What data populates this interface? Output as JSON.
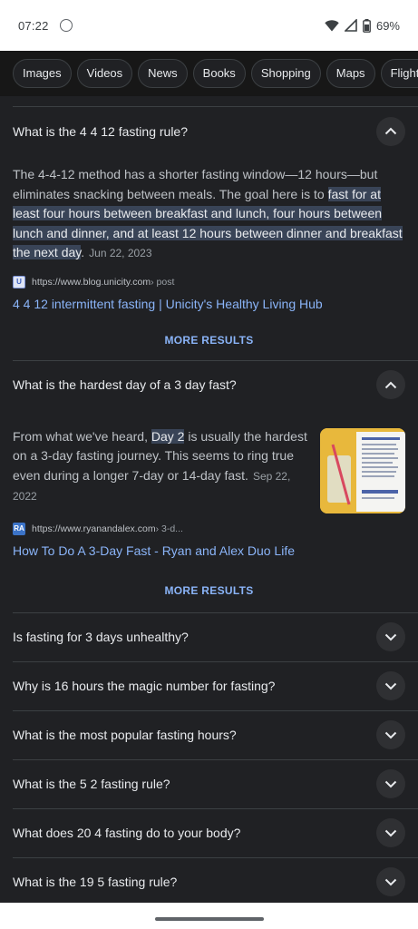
{
  "status": {
    "time": "07:22",
    "battery": "69%"
  },
  "chips": [
    "Images",
    "Videos",
    "News",
    "Books",
    "Shopping",
    "Maps",
    "Flights"
  ],
  "faq1": {
    "question": "What is the 4 4 12 fasting rule?",
    "text_before": "The 4-4-12 method has a shorter fasting window—12 hours—but eliminates snacking between meals. The goal here is to ",
    "highlight": "fast for at least four hours between breakfast and lunch, four hours between lunch and dinner, and at least 12 hours between dinner and breakfast the next day",
    "text_after": ".",
    "date": "Jun 22, 2023",
    "source_url": "https://www.blog.unicity.com",
    "source_path": " › post",
    "favicon": "U",
    "link": "4 4 12 intermittent fasting | Unicity's Healthy Living Hub",
    "more": "MORE RESULTS"
  },
  "faq2": {
    "question": "What is the hardest day of a 3 day fast?",
    "text_before": "From what we've heard, ",
    "highlight": "Day 2",
    "text_after": " is usually the hardest on a 3-day fasting journey. This seems to ring true even during a longer 7-day or 14-day fast.",
    "date": "Sep 22, 2022",
    "source_url": "https://www.ryanandalex.com",
    "source_path": " › 3-d...",
    "favicon": "RA",
    "link": "How To Do A 3-Day Fast - Ryan and Alex Duo Life",
    "more": "MORE RESULTS"
  },
  "collapsed_questions": [
    "Is fasting for 3 days unhealthy?",
    "Why is 16 hours the magic number for fasting?",
    "What is the most popular fasting hours?",
    "What is the 5 2 fasting rule?",
    "What does 20 4 fasting do to your body?",
    "What is the 19 5 fasting rule?"
  ],
  "icons": {
    "notification": "notification-icon",
    "wifi": "wifi-icon",
    "signal": "cell-signal-icon",
    "battery": "battery-icon",
    "expand": "chevron-up-icon",
    "collapse": "chevron-down-icon"
  },
  "colors": {
    "background": "#202124",
    "link": "#8ab4f8",
    "highlight": "#394457",
    "text": "#e8eaed"
  }
}
